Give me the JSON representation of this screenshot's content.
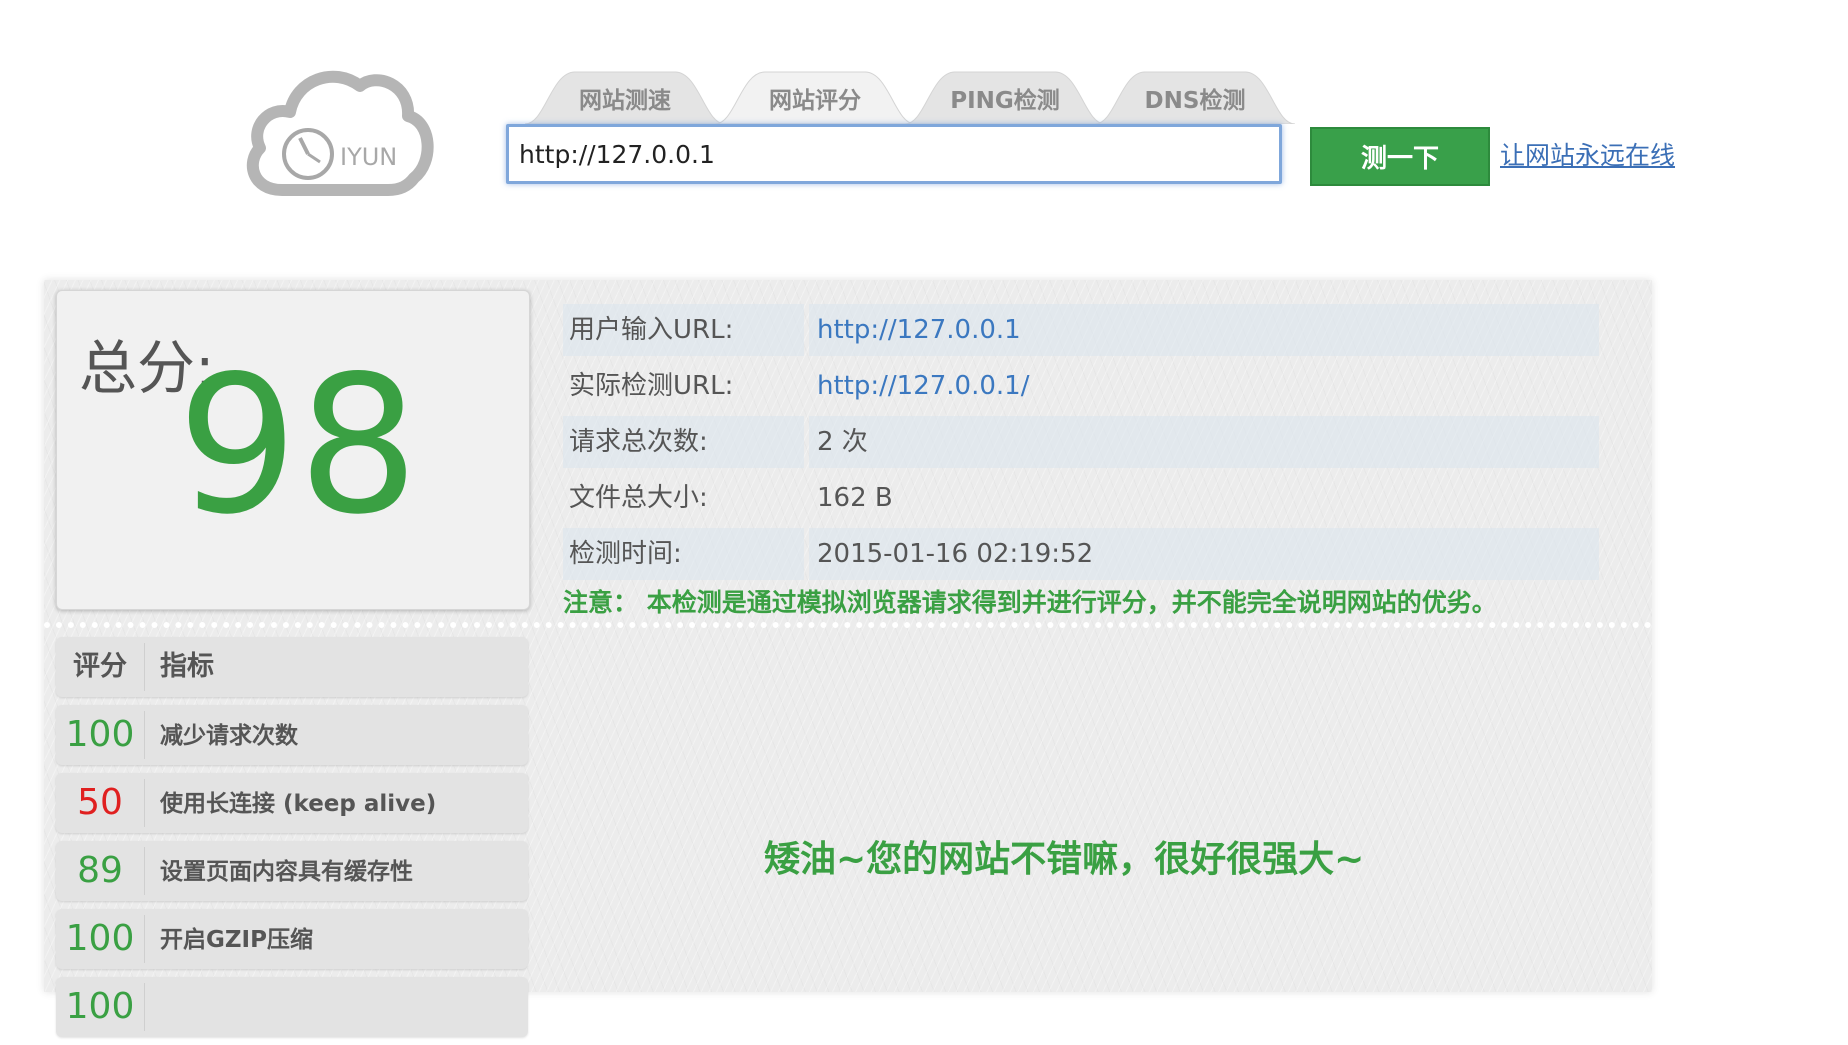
{
  "logo": {
    "text": "IYUN"
  },
  "tabs": [
    {
      "label": "网站测速",
      "active": false
    },
    {
      "label": "网站评分",
      "active": true
    },
    {
      "label": "PING检测",
      "active": false
    },
    {
      "label": "DNS检测",
      "active": false
    }
  ],
  "search": {
    "value": "http://127.0.0.1"
  },
  "test_button": {
    "label": "测一下"
  },
  "online_link": {
    "label": "让网站永远在线"
  },
  "score": {
    "label": "总分:",
    "value": "98",
    "color": "#3aa043"
  },
  "info": [
    {
      "key": "用户输入URL:",
      "value": "http://127.0.0.1"
    },
    {
      "key": "实际检测URL:",
      "value": "http://127.0.0.1/"
    },
    {
      "key": "请求总次数:",
      "value": "2 次"
    },
    {
      "key": "文件总大小:",
      "value": "162 B"
    },
    {
      "key": "检测时间:",
      "value": "2015-01-16 02:19:52"
    }
  ],
  "notice": "注意： 本检测是通过模拟浏览器请求得到并进行评分，并不能完全说明网站的优劣。",
  "metrics_header": {
    "score": "评分",
    "name": "指标"
  },
  "metrics": [
    {
      "score": "100",
      "name": "减少请求次数",
      "color": "#3aa043"
    },
    {
      "score": "50",
      "name": "使用长连接 (keep alive)",
      "color": "#e02020"
    },
    {
      "score": "89",
      "name": "设置页面内容具有缓存性",
      "color": "#3aa043"
    },
    {
      "score": "100",
      "name": "开启GZIP压缩",
      "color": "#3aa043"
    },
    {
      "score": "100",
      "name": "",
      "color": "#3aa043"
    }
  ],
  "message": "矮油~您的网站不错嘛，很好很强大~"
}
